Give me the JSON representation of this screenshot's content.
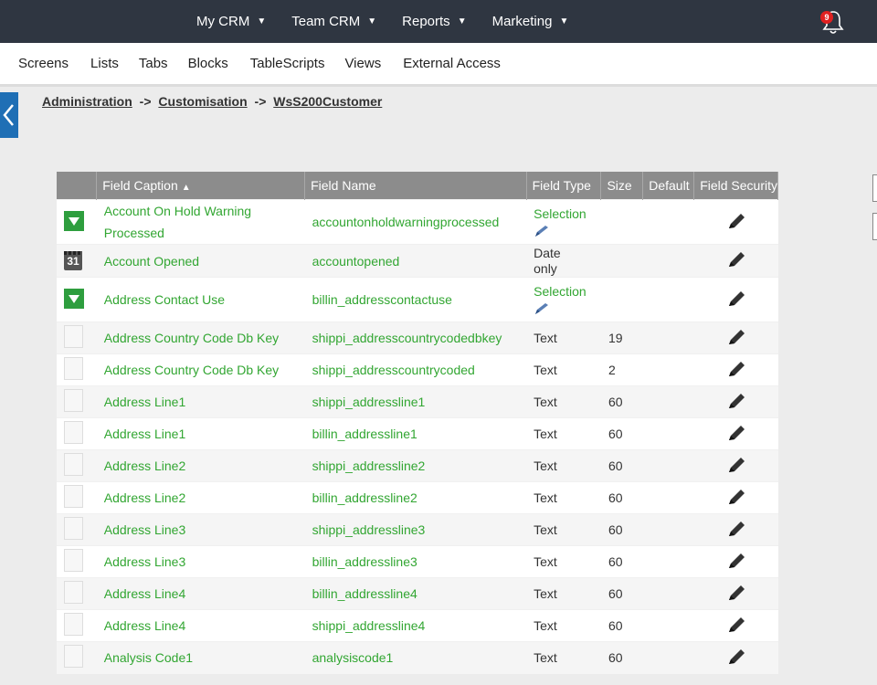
{
  "topnav": {
    "menus": [
      "My CRM",
      "Team CRM",
      "Reports",
      "Marketing"
    ],
    "notification_count": "9"
  },
  "subnav": {
    "tabs": [
      "Screens",
      "Lists",
      "Tabs",
      "Blocks",
      "TableScripts",
      "Views",
      "External Access"
    ]
  },
  "breadcrumb": {
    "items": [
      "Administration",
      "Customisation",
      "WsS200Customer"
    ],
    "separator": "->"
  },
  "table": {
    "headers": {
      "caption": "Field Caption",
      "name": "Field Name",
      "type": "Field Type",
      "size": "Size",
      "default": "Default",
      "security": "Field Security"
    },
    "rows": [
      {
        "icon": "selection-icon",
        "caption": "Account On Hold Warning Processed",
        "name": "accountonholdwarningprocessed",
        "type": "Selection",
        "size": "",
        "default": ""
      },
      {
        "icon": "calendar-icon",
        "date_icon_text": "31",
        "caption": "Account Opened",
        "name": "accountopened",
        "type": "Date only",
        "size": "",
        "default": ""
      },
      {
        "icon": "selection-icon",
        "caption": "Address Contact Use",
        "name": "billin_addresscontactuse",
        "type": "Selection",
        "size": "",
        "default": ""
      },
      {
        "icon": "text-field-icon",
        "caption": "Address Country Code Db Key",
        "name": "shippi_addresscountrycodedbkey",
        "type": "Text",
        "size": "19",
        "default": ""
      },
      {
        "icon": "text-field-icon",
        "caption": "Address Country Code Db Key",
        "name": "shippi_addresscountrycoded",
        "type": "Text",
        "size": "2",
        "default": ""
      },
      {
        "icon": "text-field-icon",
        "caption": "Address Line1",
        "name": "shippi_addressline1",
        "type": "Text",
        "size": "60",
        "default": ""
      },
      {
        "icon": "text-field-icon",
        "caption": "Address Line1",
        "name": "billin_addressline1",
        "type": "Text",
        "size": "60",
        "default": ""
      },
      {
        "icon": "text-field-icon",
        "caption": "Address Line2",
        "name": "shippi_addressline2",
        "type": "Text",
        "size": "60",
        "default": ""
      },
      {
        "icon": "text-field-icon",
        "caption": "Address Line2",
        "name": "billin_addressline2",
        "type": "Text",
        "size": "60",
        "default": ""
      },
      {
        "icon": "text-field-icon",
        "caption": "Address Line3",
        "name": "shippi_addressline3",
        "type": "Text",
        "size": "60",
        "default": ""
      },
      {
        "icon": "text-field-icon",
        "caption": "Address Line3",
        "name": "billin_addressline3",
        "type": "Text",
        "size": "60",
        "default": ""
      },
      {
        "icon": "text-field-icon",
        "caption": "Address Line4",
        "name": "billin_addressline4",
        "type": "Text",
        "size": "60",
        "default": ""
      },
      {
        "icon": "text-field-icon",
        "caption": "Address Line4",
        "name": "shippi_addressline4",
        "type": "Text",
        "size": "60",
        "default": ""
      },
      {
        "icon": "text-field-icon",
        "caption": "Analysis Code1",
        "name": "analysiscode1",
        "type": "Text",
        "size": "60",
        "default": ""
      }
    ]
  },
  "colors": {
    "topnav_bg": "#2f3641",
    "link_green": "#32a632",
    "header_gray": "#8c8c8c",
    "accent_blue": "#1f6fb5"
  }
}
